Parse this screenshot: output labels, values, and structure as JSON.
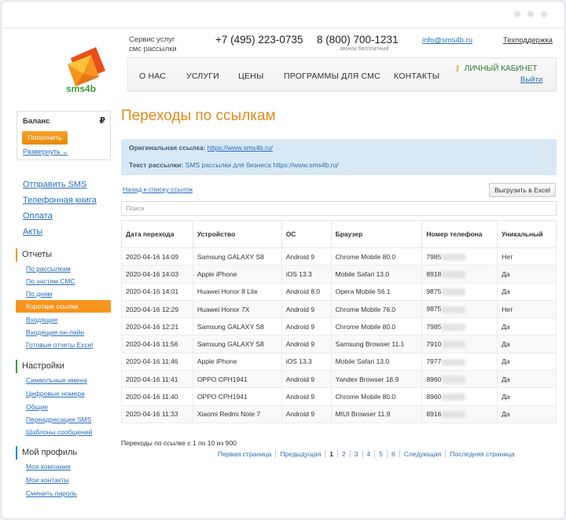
{
  "header": {
    "service_line1": "Сервис услуг",
    "service_line2": "смс рассылки",
    "phone1": "+7 (495) 223-0735",
    "phone2": "8 (800) 700-1231",
    "phone2_sub": "звонок бесплатный",
    "email": "info@sms4b.ru",
    "support": "Техподдержка",
    "logo_text": "sms4b",
    "nav": [
      "О НАС",
      "УСЛУГИ",
      "ЦЕНЫ",
      "ПРОГРАММЫ ДЛЯ СМС",
      "КОНТАКТЫ"
    ],
    "cabinet": "ЛИЧНЫЙ КАБИНЕТ",
    "logout": "Выйти"
  },
  "sidebar": {
    "balance_title": "Баланс",
    "currency": "₽",
    "topup": "Пополнить",
    "expand": "Развернуть",
    "main_links": [
      "Отправить SMS",
      "Телефонная книга",
      "Оплата",
      "Акты"
    ],
    "reports_title": "Отчеты",
    "reports": [
      "По рассылкам",
      "По частям СМС",
      "По дням",
      "Короткие ссылки",
      "Входящие",
      "Входящие он-лайн",
      "Готовые отчеты Excel"
    ],
    "settings_title": "Настройки",
    "settings": [
      "Символьные имена",
      "Цифровые номера",
      "Общие",
      "Переадресация SMS",
      "Шаблоны сообщений"
    ],
    "profile_title": "Мой профиль",
    "profile": [
      "Моя компания",
      "Мои контакты",
      "Сменить пароль"
    ],
    "colors": {
      "reports": "#f7951d",
      "settings": "#3a9d3a",
      "profile": "#2a86d1"
    }
  },
  "main": {
    "title": "Переходы по ссылкам",
    "orig_label": "Оригинальная ссылка:",
    "orig_url": "https://www.sms4b.ru/",
    "text_label": "Текст рассылки:",
    "text_value": "SMS рассылки для бизнеса https://www.sms4b.ru/",
    "back": "Назад к списку ссылок",
    "excel": "Выгрузить в Excel",
    "search_placeholder": "Поиск",
    "columns": [
      "Дата перехода",
      "Устройство",
      "ОС",
      "Браузер",
      "Номер телефона",
      "Уникальный"
    ],
    "rows": [
      [
        "2020-04-16 14:09",
        "Samsung GALAXY S8",
        "Android 9",
        "Chrome Mobile 80.0",
        "7985",
        "Нет"
      ],
      [
        "2020-04-16 14:03",
        "Apple iPhone",
        "iOS 13.3",
        "Mobile Safari 13.0",
        "8918",
        "Да"
      ],
      [
        "2020-04-16 14:01",
        "Huawei Honor 8 Lite",
        "Android 8.0",
        "Opera Mobile 56.1",
        "9875",
        "Да"
      ],
      [
        "2020-04-16 12:29",
        "Huawei Honor 7X",
        "Android 9",
        "Chrome Mobile 76.0",
        "9875",
        "Нет"
      ],
      [
        "2020-04-16 12:21",
        "Samsung GALAXY S8",
        "Android 9",
        "Chrome Mobile 80.0",
        "7985",
        "Да"
      ],
      [
        "2020-04-16 11:56",
        "Samsung GALAXY S8",
        "Android 9",
        "Samsung Browser 11.1",
        "7910",
        "Да"
      ],
      [
        "2020-04-16 11:46",
        "Apple iPhone",
        "iOS 13.3",
        "Mobile Safari 13.0",
        "7977",
        "Да"
      ],
      [
        "2020-04-16 11:41",
        "OPPO CPH1941",
        "Android 9",
        "Yandex Browser 18.9",
        "8960",
        "Да"
      ],
      [
        "2020-04-16 11:40",
        "OPPO CPH1941",
        "Android 9",
        "Chrome Mobile 80.0",
        "8960",
        "Да"
      ],
      [
        "2020-04-16 11:33",
        "Xiaomi Redmi Note 7",
        "Android 9",
        "MIUI Browser 11.9",
        "8916",
        "Да"
      ]
    ],
    "paging_info": "Переходы по ссылке с 1 по 10 из 900",
    "pager": [
      "Первая страница",
      "Предыдущая",
      "1",
      "2",
      "3",
      "4",
      "5",
      "6",
      "Следующая",
      "Последняя страница"
    ],
    "pager_current": "1"
  }
}
